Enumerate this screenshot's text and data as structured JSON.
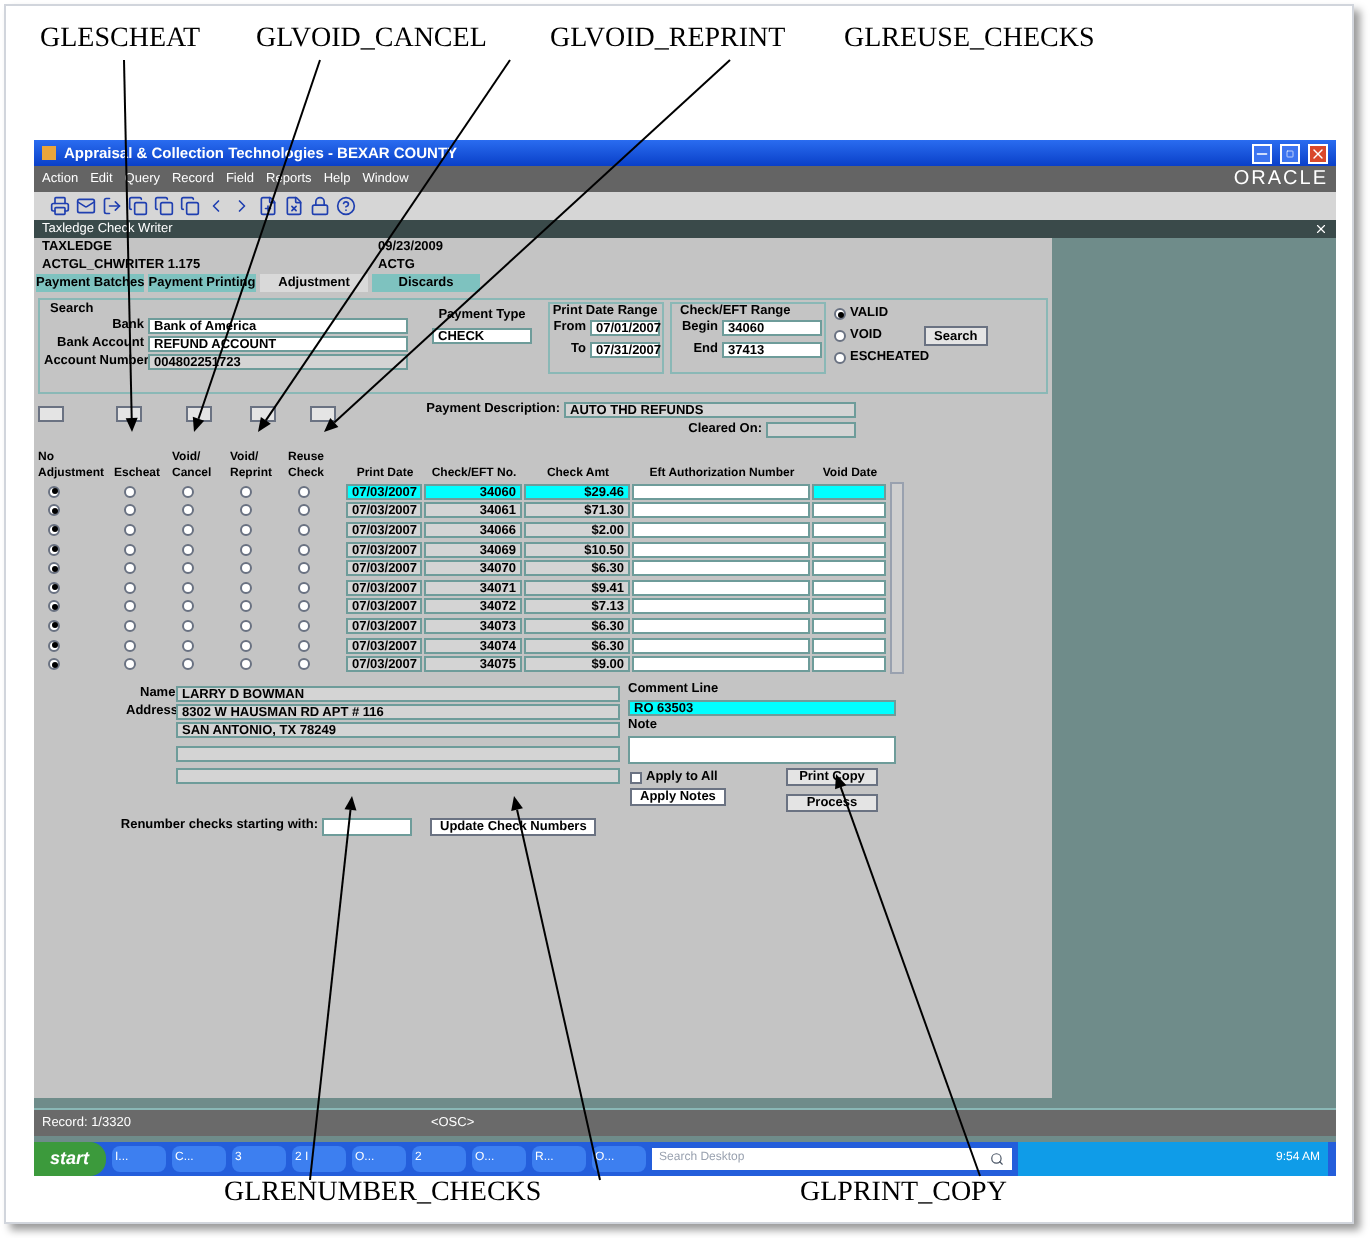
{
  "annotations_top": [
    "GLESCHEAT",
    "GLVOID_CANCEL",
    "GLVOID_REPRINT",
    "GLREUSE_CHECKS"
  ],
  "annotations_bottom": [
    "GLRENUMBER_CHECKS",
    "GLPRINT_COPY"
  ],
  "window": {
    "title": "Appraisal & Collection Technologies - BEXAR COUNTY",
    "logo": "ORACLE"
  },
  "menu": [
    "Action",
    "Edit",
    "Query",
    "Record",
    "Field",
    "Reports",
    "Help",
    "Window"
  ],
  "form": {
    "title": "Taxledge Check Writer",
    "app": "TAXLEDGE",
    "date": "09/23/2009",
    "module": "ACTGL_CHWRITER 1.175",
    "user": "ACTG"
  },
  "tabs": [
    {
      "label": "Payment Batches",
      "selected": false
    },
    {
      "label": "Payment Printing",
      "selected": false
    },
    {
      "label": "Adjustment",
      "selected": true
    },
    {
      "label": "Discards",
      "selected": false
    }
  ],
  "search": {
    "title": "Search",
    "bank_label": "Bank",
    "bank": "Bank of America",
    "account_label": "Bank Account",
    "account": "REFUND ACCOUNT",
    "number_label": "Account Number",
    "number": "004802251723",
    "payment_type_label": "Payment Type",
    "payment_type": "CHECK",
    "date_range_label": "Print Date Range",
    "from_label": "From",
    "from": "07/01/2007",
    "to_label": "To",
    "to": "07/31/2007",
    "check_range_label": "Check/EFT Range",
    "begin_label": "Begin",
    "begin": "34060",
    "end_label": "End",
    "end": "37413",
    "button": "Search",
    "statuses": [
      {
        "label": "VALID",
        "selected": true
      },
      {
        "label": "VOID",
        "selected": false
      },
      {
        "label": "ESCHEATED",
        "selected": false
      }
    ]
  },
  "payment_description_label": "Payment Description:",
  "payment_description": "AUTO THD REFUNDS",
  "cleared_on_label": "Cleared On:",
  "columns": [
    "No Adjustment",
    "Escheat",
    "Void/ Cancel",
    "Void/ Reprint",
    "Reuse Check",
    "Print Date",
    "Check/EFT No.",
    "Check Amt",
    "Eft Authorization Number",
    "Void Date"
  ],
  "rows": [
    {
      "selected": true,
      "options": [
        {
          "selected": true
        },
        {
          "selected": false
        },
        {
          "selected": false
        },
        {
          "selected": false
        },
        {
          "selected": false
        }
      ],
      "print_date": "07/03/2007",
      "check_no": "34060",
      "amount": "$29.46"
    },
    {
      "selected": false,
      "options": [
        {
          "selected": true
        },
        {
          "selected": false
        },
        {
          "selected": false
        },
        {
          "selected": false
        },
        {
          "selected": false
        }
      ],
      "print_date": "07/03/2007",
      "check_no": "34061",
      "amount": "$71.30"
    },
    {
      "selected": false,
      "options": [
        {
          "selected": true
        },
        {
          "selected": false
        },
        {
          "selected": false
        },
        {
          "selected": false
        },
        {
          "selected": false
        }
      ],
      "print_date": "07/03/2007",
      "check_no": "34066",
      "amount": "$2.00"
    },
    {
      "selected": false,
      "options": [
        {
          "selected": true
        },
        {
          "selected": false
        },
        {
          "selected": false
        },
        {
          "selected": false
        },
        {
          "selected": false
        }
      ],
      "print_date": "07/03/2007",
      "check_no": "34069",
      "amount": "$10.50"
    },
    {
      "selected": false,
      "options": [
        {
          "selected": true
        },
        {
          "selected": false
        },
        {
          "selected": false
        },
        {
          "selected": false
        },
        {
          "selected": false
        }
      ],
      "print_date": "07/03/2007",
      "check_no": "34070",
      "amount": "$6.30"
    },
    {
      "selected": false,
      "options": [
        {
          "selected": true
        },
        {
          "selected": false
        },
        {
          "selected": false
        },
        {
          "selected": false
        },
        {
          "selected": false
        }
      ],
      "print_date": "07/03/2007",
      "check_no": "34071",
      "amount": "$9.41"
    },
    {
      "selected": false,
      "options": [
        {
          "selected": true
        },
        {
          "selected": false
        },
        {
          "selected": false
        },
        {
          "selected": false
        },
        {
          "selected": false
        }
      ],
      "print_date": "07/03/2007",
      "check_no": "34072",
      "amount": "$7.13"
    },
    {
      "selected": false,
      "options": [
        {
          "selected": true
        },
        {
          "selected": false
        },
        {
          "selected": false
        },
        {
          "selected": false
        },
        {
          "selected": false
        }
      ],
      "print_date": "07/03/2007",
      "check_no": "34073",
      "amount": "$6.30"
    },
    {
      "selected": false,
      "options": [
        {
          "selected": true
        },
        {
          "selected": false
        },
        {
          "selected": false
        },
        {
          "selected": false
        },
        {
          "selected": false
        }
      ],
      "print_date": "07/03/2007",
      "check_no": "34074",
      "amount": "$6.30"
    },
    {
      "selected": false,
      "options": [
        {
          "selected": true
        },
        {
          "selected": false
        },
        {
          "selected": false
        },
        {
          "selected": false
        },
        {
          "selected": false
        }
      ],
      "print_date": "07/03/2007",
      "check_no": "34075",
      "amount": "$9.00"
    }
  ],
  "payee": {
    "name_label": "Name",
    "name": "LARRY D BOWMAN",
    "address_label": "Address",
    "address": [
      "8302 W HAUSMAN RD APT # 116",
      "SAN ANTONIO, TX 78249"
    ],
    "comment_label": "Comment Line",
    "comment": "RO 63503",
    "note_label": "Note",
    "apply_all_label": "Apply to All",
    "apply_all": false,
    "apply_notes": "Apply Notes",
    "print_copy": "Print Copy",
    "process": "Process",
    "renumber_label": "Renumber checks starting with:",
    "update_button": "Update Check Numbers"
  },
  "status_bar": {
    "record": "Record: 1/3320",
    "mode": "<OSC>"
  },
  "taskbar": {
    "start": "start",
    "items": [
      "I...",
      "C...",
      "3",
      "2 I",
      "O...",
      "2",
      "O...",
      "R...",
      "O..."
    ],
    "search_placeholder": "Search Desktop",
    "clock": "9:54 AM"
  }
}
